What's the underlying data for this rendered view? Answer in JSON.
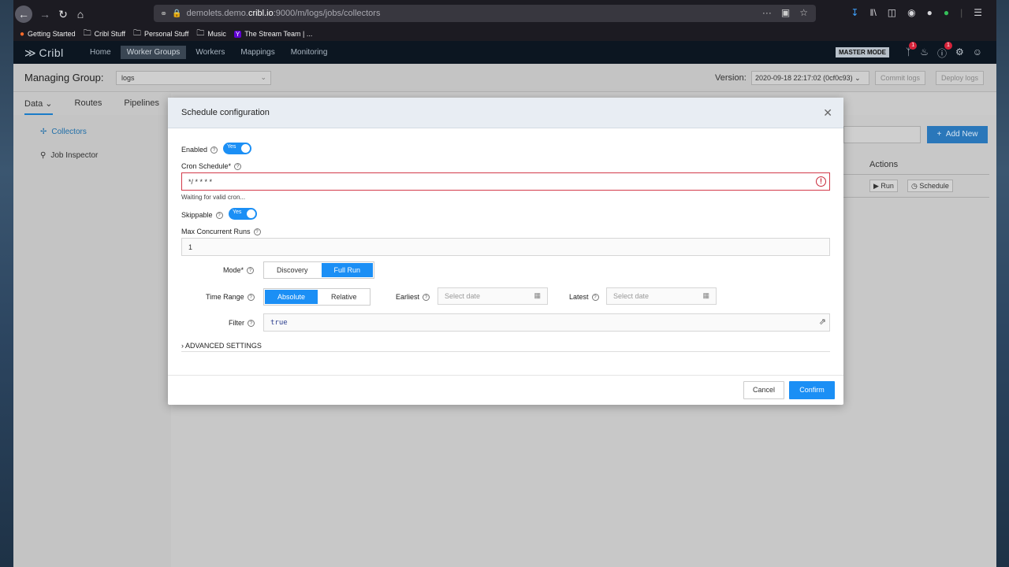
{
  "browser": {
    "url_prefix": "demolets.demo.",
    "url_host": "cribl.io",
    "url_suffix": ":9000/m/logs/jobs/collectors",
    "bookmarks": [
      "Getting Started",
      "Cribl Stuff",
      "Personal Stuff",
      "Music",
      "The Stream Team | ..."
    ]
  },
  "header": {
    "logo": "Cribl",
    "nav": [
      "Home",
      "Worker Groups",
      "Workers",
      "Mappings",
      "Monitoring"
    ],
    "active_nav": "Worker Groups",
    "mode_badge": "MASTER MODE",
    "notif_badge_1": "1",
    "notif_badge_2": "1"
  },
  "managing": {
    "label": "Managing Group:",
    "group": "logs",
    "version_label": "Version:",
    "version_value": "2020-09-18 22:17:02 (0cf0c93)",
    "commit_label": "Commit logs",
    "deploy_label": "Deploy logs"
  },
  "subnav": [
    "Data",
    "Routes",
    "Pipelines"
  ],
  "sidebar": {
    "items": [
      "Collectors",
      "Job Inspector"
    ]
  },
  "background": {
    "add_new": "Add New",
    "actions_header": "Actions",
    "run": "Run",
    "schedule": "Schedule"
  },
  "modal": {
    "title": "Schedule configuration",
    "enabled_label": "Enabled",
    "enabled_value": "Yes",
    "cron_label": "Cron Schedule*",
    "cron_value": "*/ * * * *",
    "cron_hint": "Waiting for valid cron...",
    "skippable_label": "Skippable",
    "skippable_value": "Yes",
    "max_runs_label": "Max Concurrent Runs",
    "max_runs_value": "1",
    "mode_label": "Mode*",
    "mode_options": [
      "Discovery",
      "Full Run"
    ],
    "mode_selected": "Full Run",
    "time_range_label": "Time Range",
    "time_range_options": [
      "Absolute",
      "Relative"
    ],
    "time_range_selected": "Absolute",
    "earliest_label": "Earliest",
    "earliest_placeholder": "Select date",
    "latest_label": "Latest",
    "latest_placeholder": "Select date",
    "filter_label": "Filter",
    "filter_value": "true",
    "advanced_label": "ADVANCED SETTINGS",
    "cancel_label": "Cancel",
    "confirm_label": "Confirm"
  },
  "colors": {
    "accent": "#1b8ff5",
    "error": "#d33a4a"
  }
}
